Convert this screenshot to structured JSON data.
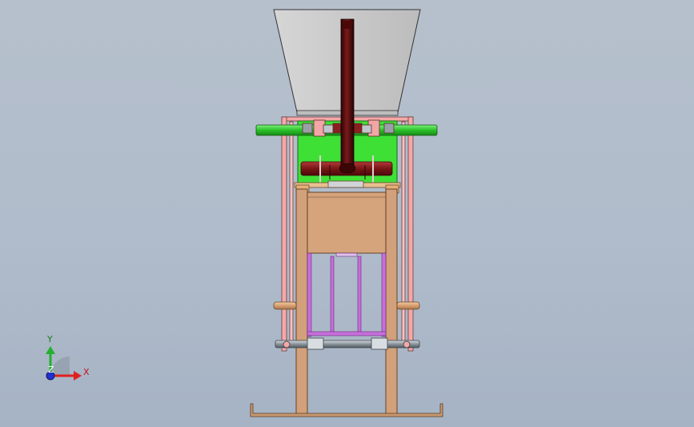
{
  "triad": {
    "x_label": "X",
    "y_label": "Y",
    "z_label": "Z",
    "x_color": "#e02020",
    "y_color": "#22b030",
    "z_color": "#2030d0"
  },
  "colors": {
    "hopper": "#c9c9c9",
    "chute": "#5a0e0e",
    "frame_pink": "#f0a6a6",
    "frame_wood": "#d1a179",
    "green_plate": "#3fe03a",
    "shaft_green": "#33c83a",
    "roller_red": "#8a1f1f",
    "magenta_rod": "#c46bd8",
    "steel": "#9aa0a8"
  }
}
